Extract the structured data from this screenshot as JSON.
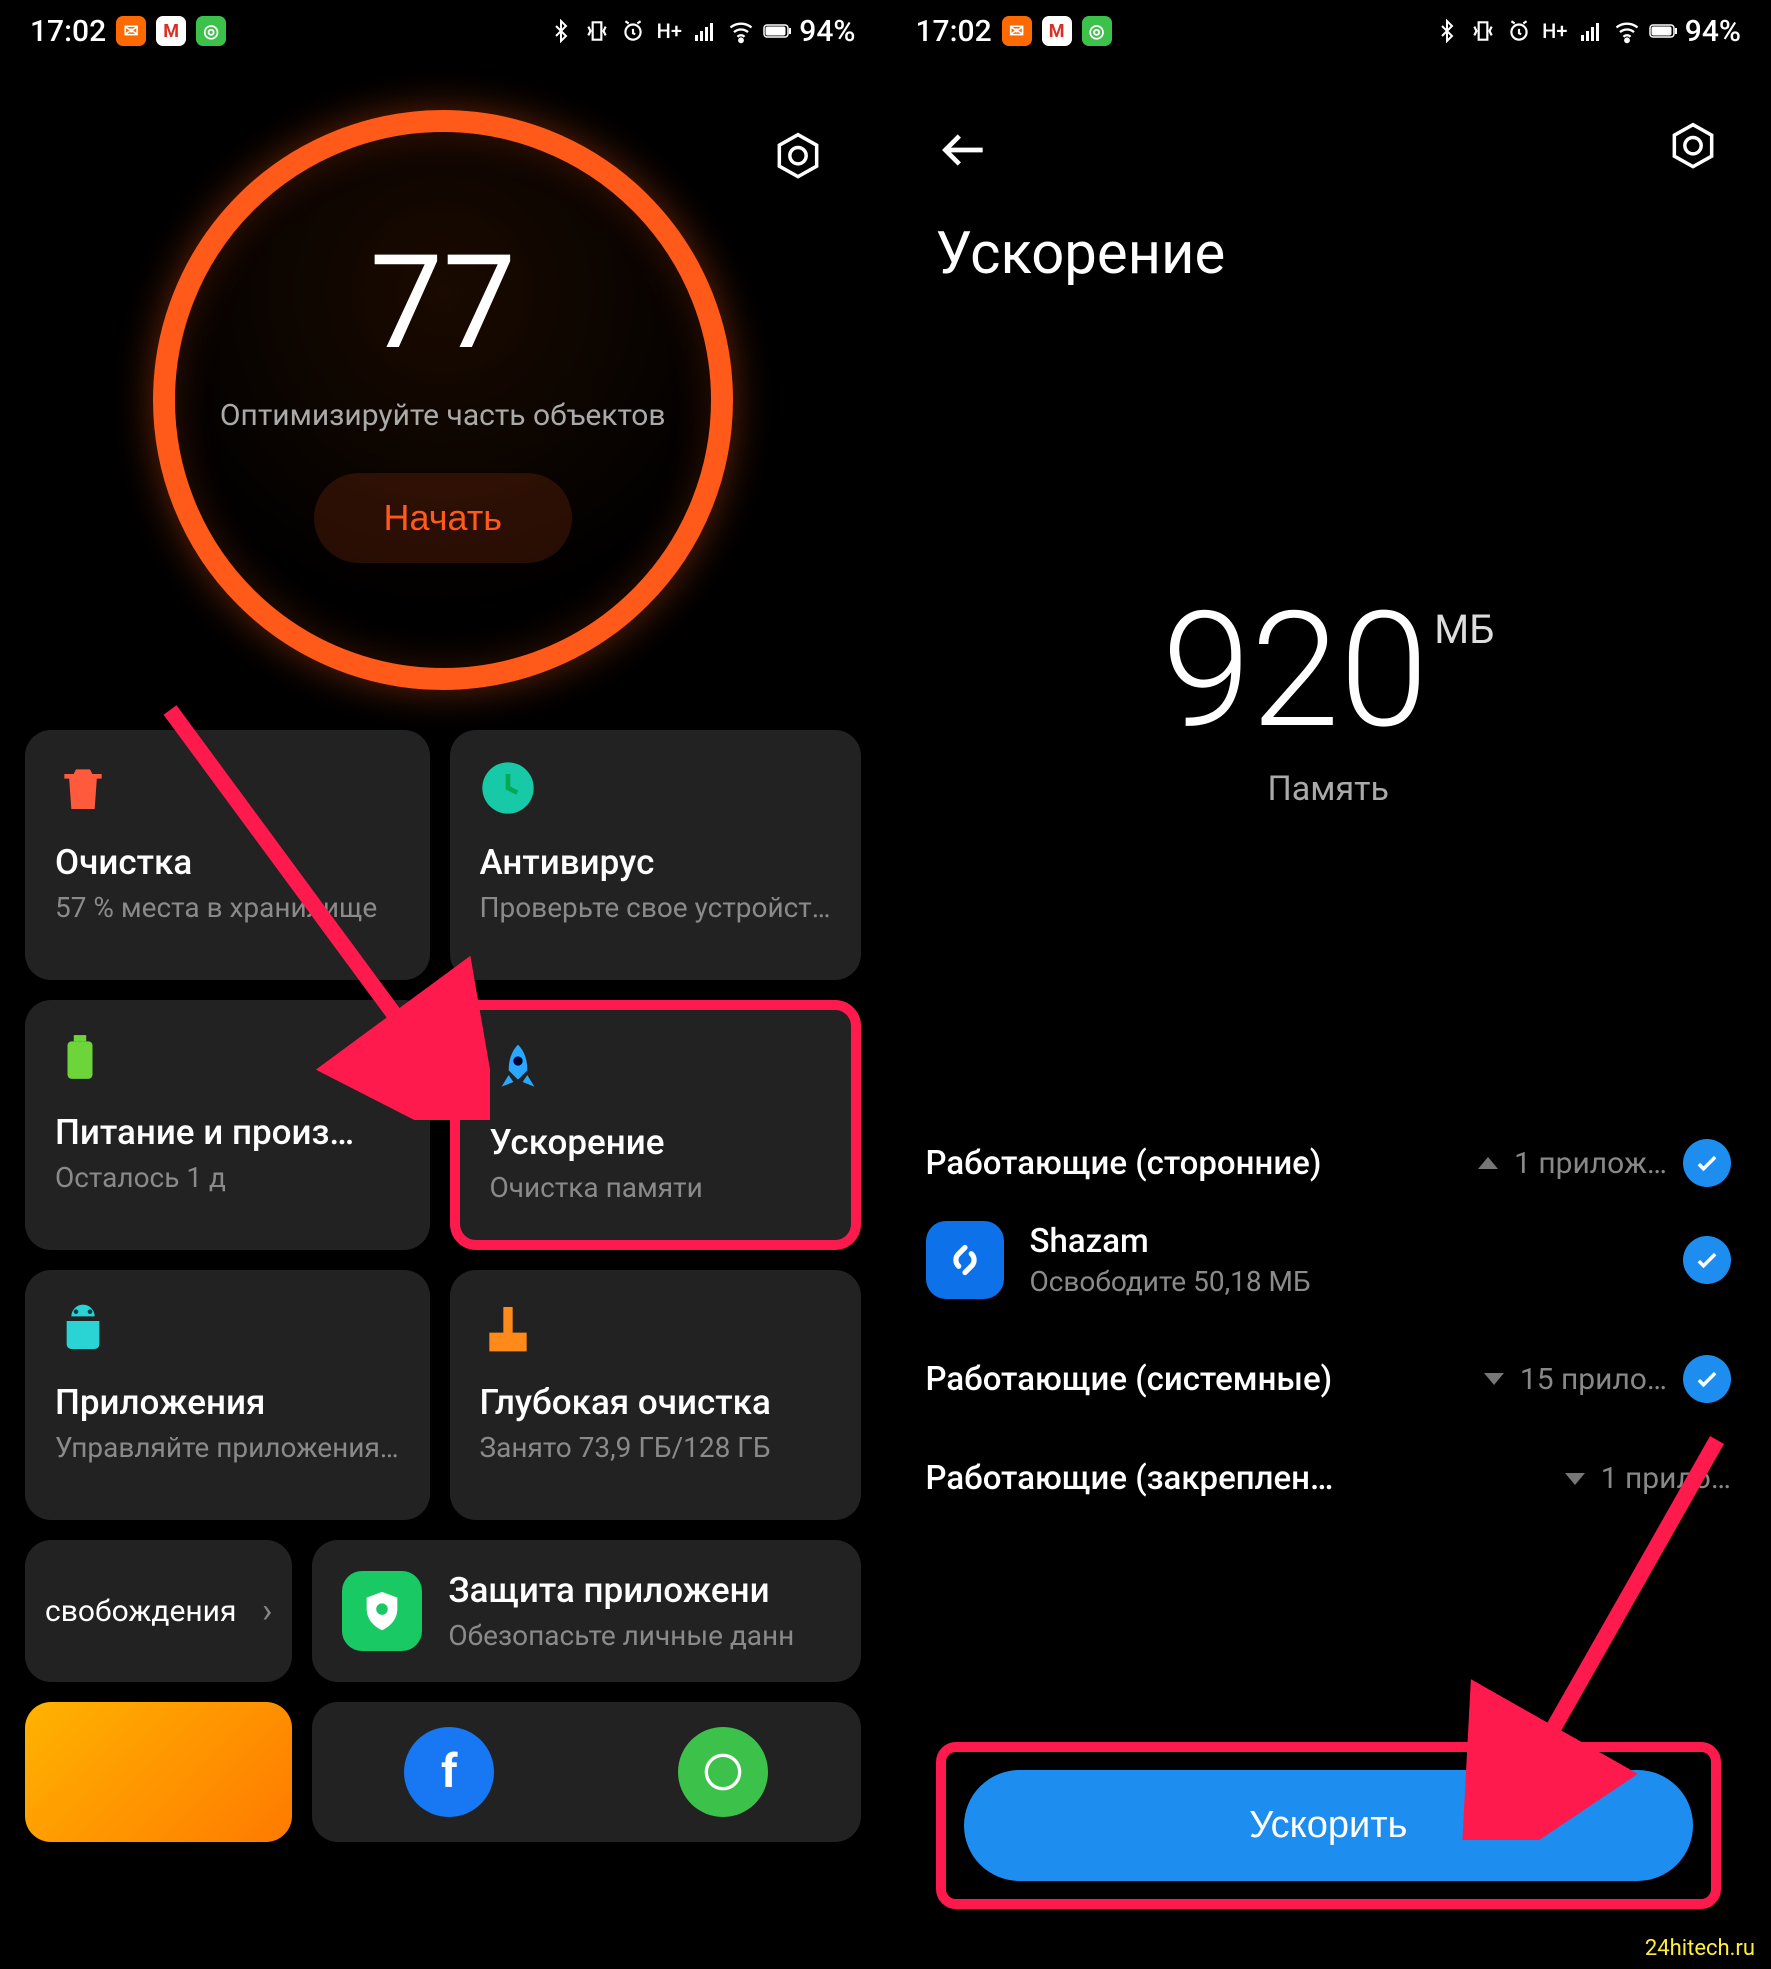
{
  "status": {
    "time": "17:02",
    "battery": "94%"
  },
  "left": {
    "score": "77",
    "score_hint": "Оптимизируйте часть объектов",
    "start_label": "Начать",
    "tiles": {
      "clean": {
        "title": "Очистка",
        "sub": "57 % места в хранилище"
      },
      "antivirus": {
        "title": "Антивирус",
        "sub": "Проверьте свое устройст…"
      },
      "power": {
        "title": "Питание и произ…",
        "sub": "Осталось 1 д"
      },
      "boost": {
        "title": "Ускорение",
        "sub": "Очистка памяти"
      },
      "apps": {
        "title": "Приложения",
        "sub": "Управляйте приложения…"
      },
      "deep": {
        "title": "Глубокая очистка",
        "sub": "Занято 73,9 ГБ/128 ГБ"
      }
    },
    "peek_label": "свобождения",
    "protect": {
      "title": "Защита приложени",
      "sub": "Обезопасьте личные данн"
    }
  },
  "right": {
    "title": "Ускорение",
    "mem_value": "920",
    "mem_unit": "МБ",
    "mem_label": "Память",
    "group1": {
      "title": "Работающие (сторонние)",
      "meta": "1 прилож…"
    },
    "app1": {
      "name": "Shazam",
      "sub": "Освободите 50,18 МБ"
    },
    "group2": {
      "title": "Работающие (системные)",
      "meta": "15 прило…"
    },
    "group3": {
      "title": "Работающие (закреплен…",
      "meta": "1 прило…"
    },
    "boost_label": "Ускорить"
  },
  "watermark": "24hitech.ru"
}
